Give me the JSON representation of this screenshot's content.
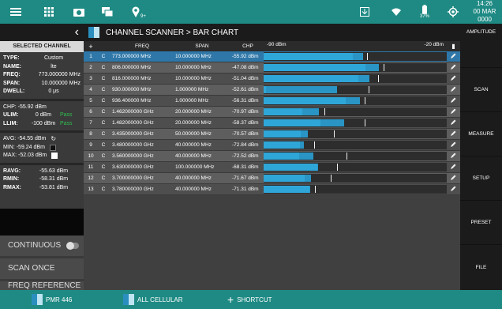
{
  "topbar": {
    "icons": [
      "menu-icon",
      "apps-icon",
      "camera-icon",
      "folder-icon",
      "gps-icon",
      "download-icon",
      "wifi-icon",
      "battery-icon",
      "crosshair-icon"
    ],
    "gps_badge": "9+",
    "battery_pct": "37%",
    "time": "14:26",
    "date": "00 MAR 0000"
  },
  "left": {
    "header": "SELECTED CHANNEL",
    "type": {
      "k": "TYPE:",
      "v": "Custom"
    },
    "name": {
      "k": "NAME:",
      "v": "lte"
    },
    "freq": {
      "k": "FREQ:",
      "v": "773.000000 MHz"
    },
    "span": {
      "k": "SPAN:",
      "v": "10.000000 MHz"
    },
    "dwell": {
      "k": "DWELL:",
      "v": "0 μs"
    },
    "chp": "CHP:  -55.92 dBm",
    "ulim": {
      "k": "ULIM:",
      "v": "0 dBm",
      "s": "Pass"
    },
    "llim": {
      "k": "LLIM:",
      "v": "-100 dBm",
      "s": "Pass"
    },
    "avg": "AVG:  -54.55 dBm",
    "min": "MIN:  -59.24 dBm",
    "max": "MAX:  -52.03 dBm",
    "ravg": {
      "k": "RAVG:",
      "v": "-55.63 dBm"
    },
    "rmin": {
      "k": "RMIN:",
      "v": "-58.31 dBm"
    },
    "rmax": {
      "k": "RMAX:",
      "v": "-53.81 dBm"
    },
    "btn_continuous": "CONTINUOUS",
    "btn_scan_once": "SCAN ONCE",
    "btn_freq_ref": "FREQ REFERENCE"
  },
  "main": {
    "breadcrumb": "CHANNEL SCANNER  >  BAR CHART",
    "cols": {
      "add": "+",
      "freq": "FREQ",
      "span": "SPAN",
      "chp": "CHP",
      "scale_min": "-90 dBm",
      "scale_max": "-20 dBm"
    },
    "rows": [
      {
        "no": "1",
        "t": "C",
        "freq": "773.000000 MHz",
        "span": "10.000000 MHz",
        "chp": "-55.92 dBm",
        "cur": -55.92,
        "pk": -52.0,
        "mk": -50.5
      },
      {
        "no": "2",
        "t": "C",
        "freq": "806.000000 MHz",
        "span": "10.000000 MHz",
        "chp": "-47.08 dBm",
        "cur": -51.2,
        "pk": -45.9,
        "mk": -44.1
      },
      {
        "no": "3",
        "t": "C",
        "freq": "816.000000 MHz",
        "span": "10.000000 MHz",
        "chp": "-51.04 dBm",
        "cur": -53.8,
        "pk": -49.5,
        "mk": -46.4
      },
      {
        "no": "4",
        "t": "C",
        "freq": "930.000000 MHz",
        "span": "1.000000 MHz",
        "chp": "-52.61 dBm",
        "cur": -89.2,
        "pk": -61.8,
        "mk": -50.0
      },
      {
        "no": "5",
        "t": "C",
        "freq": "936.400000 MHz",
        "span": "1.000000 MHz",
        "chp": "-56.31 dBm",
        "cur": -58.6,
        "pk": -53.1,
        "mk": -51.5
      },
      {
        "no": "6",
        "t": "C",
        "freq": "1.462000000 GHz",
        "span": "20.000000 MHz",
        "chp": "-70.97 dBm",
        "cur": -75.1,
        "pk": -69.0,
        "mk": -66.8
      },
      {
        "no": "7",
        "t": "C",
        "freq": "1.482000000 GHz",
        "span": "20.000000 MHz",
        "chp": "-58.37 dBm",
        "cur": -68.4,
        "pk": -59.3,
        "mk": -51.5
      },
      {
        "no": "8",
        "t": "C",
        "freq": "3.435000000 GHz",
        "span": "50.000000 MHz",
        "chp": "-70.57 dBm",
        "cur": -75.8,
        "pk": -73.1,
        "mk": -63.2
      },
      {
        "no": "9",
        "t": "C",
        "freq": "3.480000000 GHz",
        "span": "40.000000 MHz",
        "chp": "-72.84 dBm",
        "cur": -76.0,
        "pk": -74.6,
        "mk": -70.6
      },
      {
        "no": "10",
        "t": "C",
        "freq": "3.560000000 GHz",
        "span": "40.000000 MHz",
        "chp": "-72.52 dBm",
        "cur": -76.5,
        "pk": -71.0,
        "mk": -58.2
      },
      {
        "no": "11",
        "t": "C",
        "freq": "3.630000000 GHz",
        "span": "100.000000 MHz",
        "chp": "-68.31 dBm",
        "cur": -69.5,
        "pk": -69.2,
        "mk": -62.0
      },
      {
        "no": "12",
        "t": "C",
        "freq": "3.700000000 GHz",
        "span": "40.000000 MHz",
        "chp": "-71.67 dBm",
        "cur": -74.3,
        "pk": -71.8,
        "mk": -64.5
      },
      {
        "no": "13",
        "t": "C",
        "freq": "3.780000000 GHz",
        "span": "40.000000 MHz",
        "chp": "-71.31 dBm",
        "cur": -72.6,
        "pk": -72.1,
        "mk": -70.3
      }
    ]
  },
  "right": [
    "AMPLITUDE",
    "SCAN",
    "MEASURE",
    "SETUP",
    "PRESET",
    "FILE"
  ],
  "bottom": {
    "b1": "PMR 446",
    "b2": "ALL CELLULAR",
    "b3": "SHORTCUT",
    "b3_icon": "+"
  },
  "colors": {
    "teal": "#1f8a84",
    "bar": "#2fa6d8",
    "selected": "#2f77a8",
    "pass": "#2fbf4f"
  }
}
